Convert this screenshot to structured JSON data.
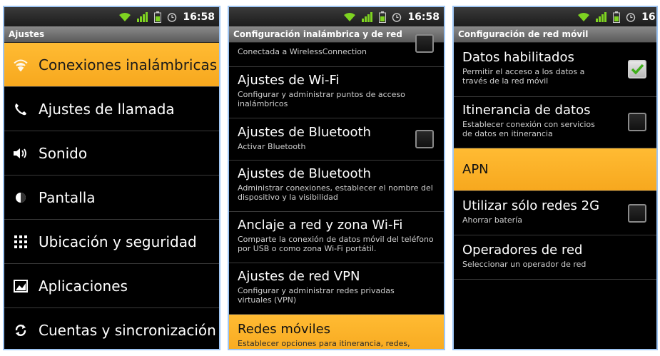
{
  "status": {
    "time": "16:58",
    "time_partial": "16:5"
  },
  "colors": {
    "accent": "#f7a81e",
    "border": "#9ec5f3",
    "background": "#000000"
  },
  "panel1": {
    "title": "Ajustes",
    "items": [
      {
        "label": "Conexiones inalámbricas",
        "icon": "wifi-icon",
        "selected": true
      },
      {
        "label": "Ajustes de llamada",
        "icon": "phone-icon"
      },
      {
        "label": "Sonido",
        "icon": "speaker-icon"
      },
      {
        "label": "Pantalla",
        "icon": "brightness-icon"
      },
      {
        "label": "Ubicación y seguridad",
        "icon": "grid-icon"
      },
      {
        "label": "Aplicaciones",
        "icon": "apps-icon"
      },
      {
        "label": "Cuentas y sincronización",
        "icon": "sync-icon"
      }
    ]
  },
  "panel2": {
    "title": "Configuración inalámbrica y de red",
    "items": [
      {
        "summary": "Conectada a WirelessConnection"
      },
      {
        "title": "Ajustes de Wi-Fi",
        "summary": "Configurar y administrar puntos de acceso inalámbricos"
      },
      {
        "title": "Ajustes de Bluetooth",
        "summary": "Activar Bluetooth",
        "checkbox": false
      },
      {
        "title": "Ajustes de Bluetooth",
        "summary": "Administrar conexiones, establecer el nombre del dispositivo y la visibilidad"
      },
      {
        "title": "Anclaje a red y zona Wi-Fi",
        "summary": "Comparte la conexión de datos móvil del teléfono por USB o como zona Wi-Fi portátil."
      },
      {
        "title": "Ajustes de red VPN",
        "summary": "Configurar y administrar redes privadas virtuales (VPN)"
      },
      {
        "title": "Redes móviles",
        "summary": "Establecer opciones para itinerancia, redes, APN",
        "selected": true
      }
    ]
  },
  "panel3": {
    "title": "Configuración de red móvil",
    "items": [
      {
        "title": "Datos habilitados",
        "summary": "Permitir el acceso a los datos a través de la red móvil",
        "checkbox": true
      },
      {
        "title": "Itinerancia de datos",
        "summary": "Establecer conexión con servicios de datos en itinerancia",
        "checkbox": false
      },
      {
        "title": "APN",
        "selected": true
      },
      {
        "title": "Utilizar sólo redes 2G",
        "summary": "Ahorrar batería",
        "checkbox": false
      },
      {
        "title": "Operadores de red",
        "summary": "Seleccionar un operador de red"
      }
    ]
  }
}
